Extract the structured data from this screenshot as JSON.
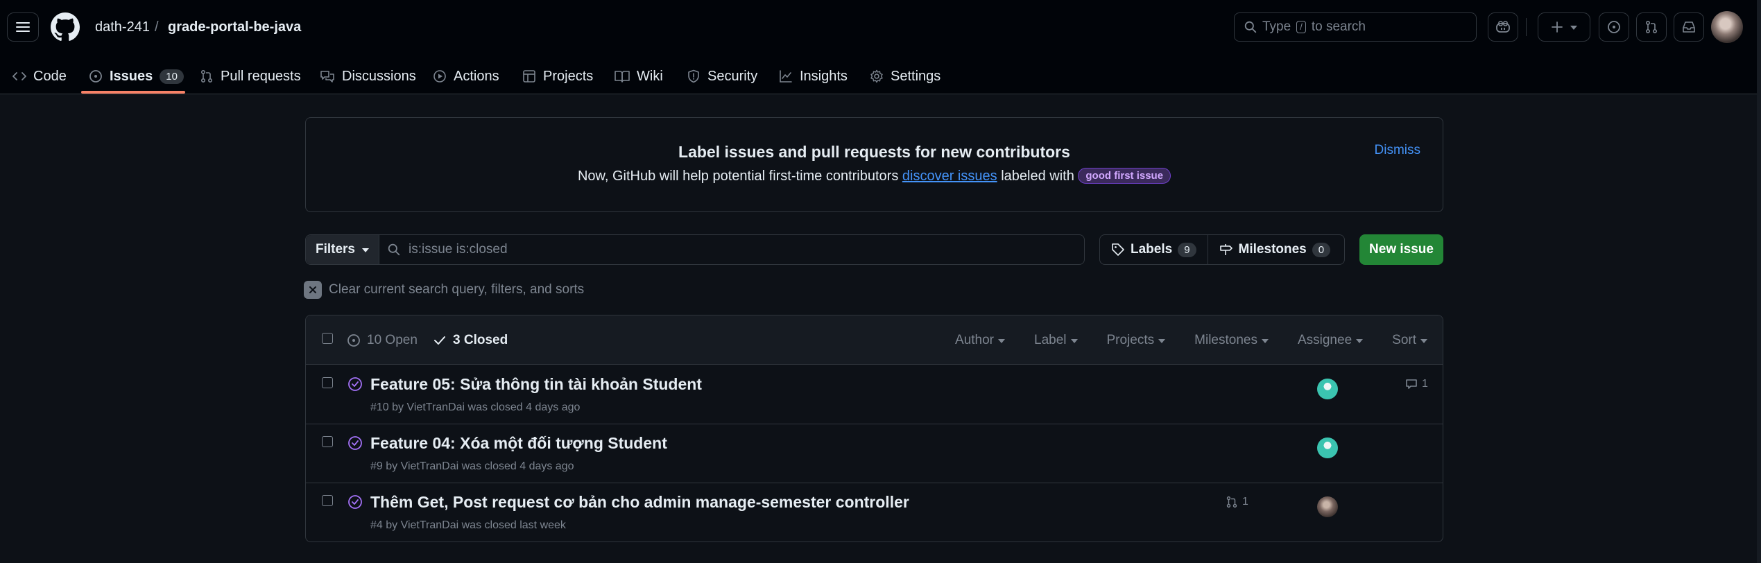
{
  "repo": {
    "owner": "dath-241",
    "separator": "/",
    "name": "grade-portal-be-java"
  },
  "search": {
    "type_text": "Type",
    "slash": "/",
    "to_search": "to search"
  },
  "tabs": [
    {
      "label": "Code",
      "icon": "code-icon"
    },
    {
      "label": "Issues",
      "icon": "issue-opened-icon",
      "count": "10",
      "selected": true
    },
    {
      "label": "Pull requests",
      "icon": "git-pull-request-icon"
    },
    {
      "label": "Discussions",
      "icon": "comment-discussion-icon"
    },
    {
      "label": "Actions",
      "icon": "play-icon"
    },
    {
      "label": "Projects",
      "icon": "table-icon"
    },
    {
      "label": "Wiki",
      "icon": "book-icon"
    },
    {
      "label": "Security",
      "icon": "shield-icon"
    },
    {
      "label": "Insights",
      "icon": "graph-icon"
    },
    {
      "label": "Settings",
      "icon": "gear-icon"
    }
  ],
  "banner": {
    "title": "Label issues and pull requests for new contributors",
    "desc_before": "Now, GitHub will help potential first-time contributors",
    "link": "discover issues",
    "desc_after": "labeled with",
    "label": "good first issue",
    "dismiss": "Dismiss"
  },
  "filters": {
    "button": "Filters",
    "query": "is:issue is:closed",
    "labels": "Labels",
    "labels_count": "9",
    "milestones": "Milestones",
    "milestones_count": "0",
    "new_issue": "New issue",
    "clear": "Clear current search query, filters, and sorts"
  },
  "list_header": {
    "open": "10 Open",
    "closed": "3 Closed",
    "sorters": [
      "Author",
      "Label",
      "Projects",
      "Milestones",
      "Assignee",
      "Sort"
    ]
  },
  "issues": [
    {
      "title": "Feature 05: Sửa thông tin tài khoản Student",
      "meta": "#10 by VietTranDai was closed 4 days ago",
      "comments": "1",
      "assignee": "teal"
    },
    {
      "title": "Feature 04: Xóa một đối tượng Student",
      "meta": "#9 by VietTranDai was closed 4 days ago",
      "assignee": "teal"
    },
    {
      "title": "Thêm Get, Post request cơ bản cho admin manage-semester controller",
      "meta": "#4 by VietTranDai was closed last week",
      "linked_prs": "1",
      "assignee": "photo"
    }
  ],
  "colors": {
    "background": "#0d1117",
    "header": "#010409",
    "border": "#30363d",
    "accent_link": "#4493f8",
    "closed_purple": "#a371f7",
    "primary_button": "#238636",
    "tab_underline": "#f78166"
  }
}
